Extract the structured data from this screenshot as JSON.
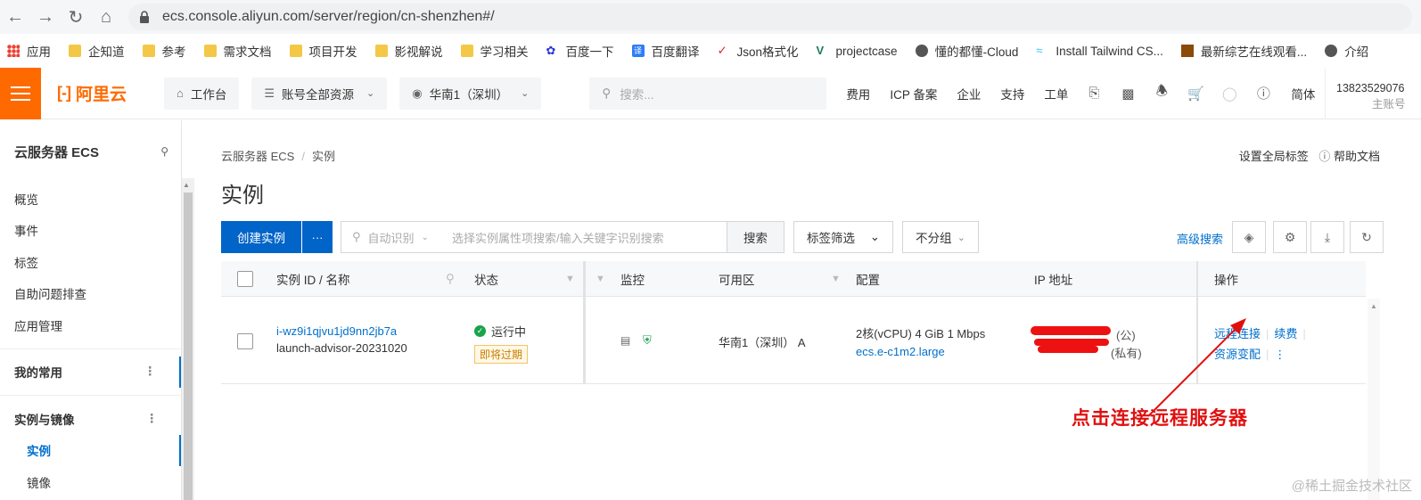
{
  "browser": {
    "url": "ecs.console.aliyun.com/server/region/cn-shenzhen#/",
    "bookmarks": [
      "应用",
      "企知道",
      "参考",
      "需求文档",
      "项目开发",
      "影视解说",
      "学习相关",
      "百度一下",
      "百度翻译",
      "Json格式化",
      "projectcase",
      "懂的都懂-Cloud",
      "Install Tailwind CS...",
      "最新综艺在线观看...",
      "介绍"
    ]
  },
  "topnav": {
    "logo": "阿里云",
    "workbench": "工作台",
    "resources": "账号全部资源",
    "region": "华南1（深圳）",
    "search_placeholder": "搜索...",
    "links": [
      "费用",
      "ICP 备案",
      "企业",
      "支持",
      "工单"
    ],
    "lang": "简体",
    "account_id": "13823529076",
    "account_sub": "主账号"
  },
  "sidebar": {
    "title": "云服务器 ECS",
    "items": [
      "概览",
      "事件",
      "标签",
      "自助问题排查",
      "应用管理"
    ],
    "group1": "我的常用",
    "group2": "实例与镜像",
    "active": "实例",
    "sub": "镜像"
  },
  "main": {
    "crumb_root": "云服务器 ECS",
    "crumb_current": "实例",
    "global_tag": "设置全局标签",
    "help": "帮助文档",
    "title": "实例",
    "create": "创建实例",
    "more": "···",
    "search_prefix": "自动识别",
    "search_placeholder": "选择实例属性项搜索/输入关键字识别搜索",
    "search_btn": "搜索",
    "tag_filter": "标签筛选",
    "group": "不分组",
    "advanced": "高级搜索"
  },
  "table": {
    "headers": [
      "实例 ID / 名称",
      "状态",
      "监控",
      "可用区",
      "配置",
      "IP 地址",
      "操作"
    ],
    "row": {
      "id": "i-wz9i1qjvu1jd9nn2jb7a",
      "name": "launch-advisor-20231020",
      "status": "运行中",
      "badge": "即将过期",
      "zone": "华南1（深圳） A",
      "config": "2核(vCPU)  4 GiB  1 Mbps",
      "spec": "ecs.e-c1m2.large",
      "ip_public_tag": "(公)",
      "ip_private_tag": "(私有)",
      "op1": "远程连接",
      "op2": "续费",
      "op3": "资源变配",
      "op_more": "⋮"
    }
  },
  "annotation": "点击连接远程服务器",
  "watermark": "@稀土掘金技术社区",
  "colors": {
    "brand": "#ff6a00",
    "primary": "#0064c8",
    "link": "#0070cc",
    "redline": "#e01010"
  }
}
